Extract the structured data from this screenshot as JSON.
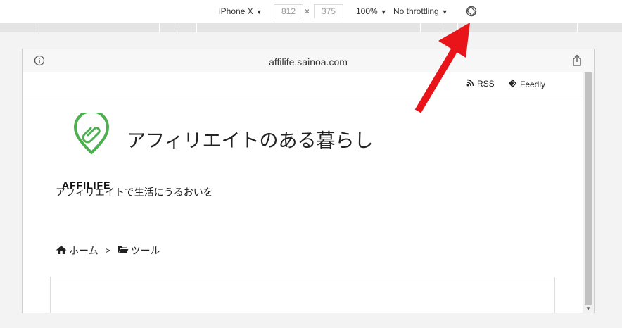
{
  "devtools": {
    "device_name": "iPhone X",
    "width_value": "812",
    "height_value": "375",
    "times_symbol": "×",
    "zoom": "100%",
    "throttling": "No throttling",
    "caret": "▼"
  },
  "browser": {
    "url": "affilife.sainoa.com"
  },
  "site": {
    "nav": {
      "rss_label": "RSS",
      "feedly_label": "Feedly"
    },
    "logo_text": "AFFILIFE",
    "title": "アフィリエイトのある暮らし",
    "tagline": "アフィリエイトで生活にうるおいを",
    "breadcrumb": {
      "home": "ホーム",
      "separator": ">",
      "category": "ツール"
    }
  },
  "colors": {
    "logo_green": "#4caf50",
    "arrow_red": "#e8141a"
  },
  "icons": [
    "rotate-icon",
    "info-icon",
    "share-icon",
    "rss-icon",
    "feedly-icon",
    "home-icon",
    "folder-icon",
    "arrow-annotation"
  ]
}
